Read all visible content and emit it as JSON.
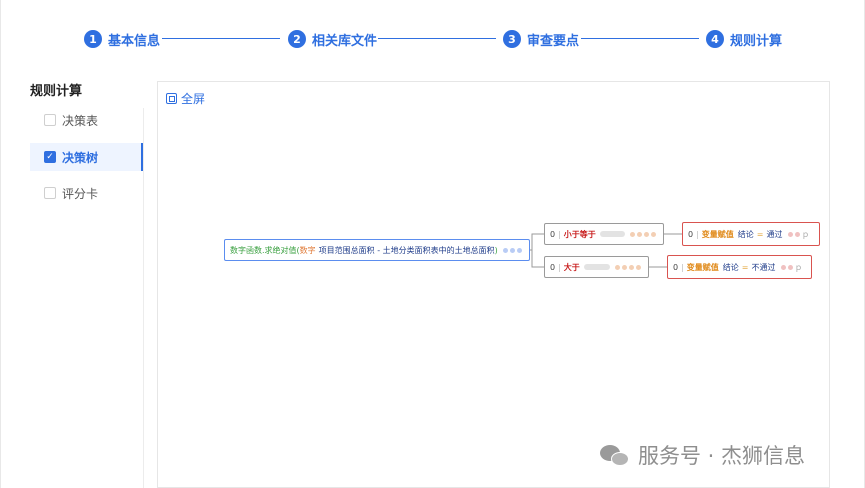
{
  "steps": [
    {
      "num": "1",
      "label": "基本信息"
    },
    {
      "num": "2",
      "label": "相关库文件"
    },
    {
      "num": "3",
      "label": "审查要点"
    },
    {
      "num": "4",
      "label": "规则计算"
    }
  ],
  "sidebar": {
    "title": "规则计算",
    "items": [
      {
        "label": "决策表",
        "checked": false
      },
      {
        "label": "决策树",
        "checked": true
      },
      {
        "label": "评分卡",
        "checked": false
      }
    ]
  },
  "canvas": {
    "fullscreen_label": "全屏",
    "root": {
      "fn": "数字函数.求绝对值(",
      "arg_type": "数字",
      "arg_text": "项目范围总面积 - 土地分类面积表中的土地总面积",
      "close": ")"
    },
    "branches": [
      {
        "index": "0",
        "operator": "小于等于",
        "leaf": {
          "index": "0",
          "action": "变量赋值",
          "var": "结论",
          "eq": "=",
          "value": "通过",
          "tail": "ｐ"
        }
      },
      {
        "index": "0",
        "operator": "大于",
        "leaf": {
          "index": "0",
          "action": "变量赋值",
          "var": "结论",
          "eq": "=",
          "value": "不通过",
          "tail": "ｐ"
        }
      }
    ]
  },
  "watermark": "服务号 · 杰狮信息",
  "colors": {
    "accent": "#2f6fe0",
    "leaf_border": "#d9534f",
    "root_border": "#5b8def"
  }
}
